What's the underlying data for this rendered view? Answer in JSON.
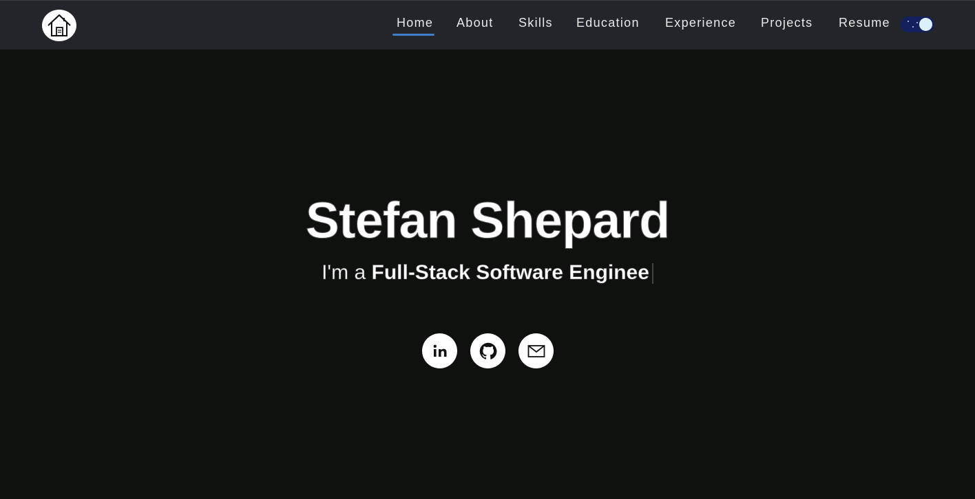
{
  "header": {
    "logo_icon": "house-icon",
    "nav": [
      {
        "label": "Home",
        "active": true
      },
      {
        "label": "About",
        "active": false
      },
      {
        "label": "Skills",
        "active": false
      },
      {
        "label": "Education",
        "active": false
      },
      {
        "label": "Experience",
        "active": false
      },
      {
        "label": "Projects",
        "active": false
      },
      {
        "label": "Resume",
        "active": false
      }
    ],
    "theme_toggle_icon": "dark-mode-toggle"
  },
  "hero": {
    "name": "Stefan Shepard",
    "subtitle_prefix": "I'm a ",
    "subtitle_role": "Full-Stack Software Enginee"
  },
  "socials": [
    {
      "icon": "linkedin-icon",
      "label": "in"
    },
    {
      "icon": "github-icon"
    },
    {
      "icon": "email-icon"
    }
  ],
  "colors": {
    "background": "#0f110f",
    "navbar": "#23252b",
    "accent": "#3f7dc8",
    "toggle": "#13205c"
  }
}
